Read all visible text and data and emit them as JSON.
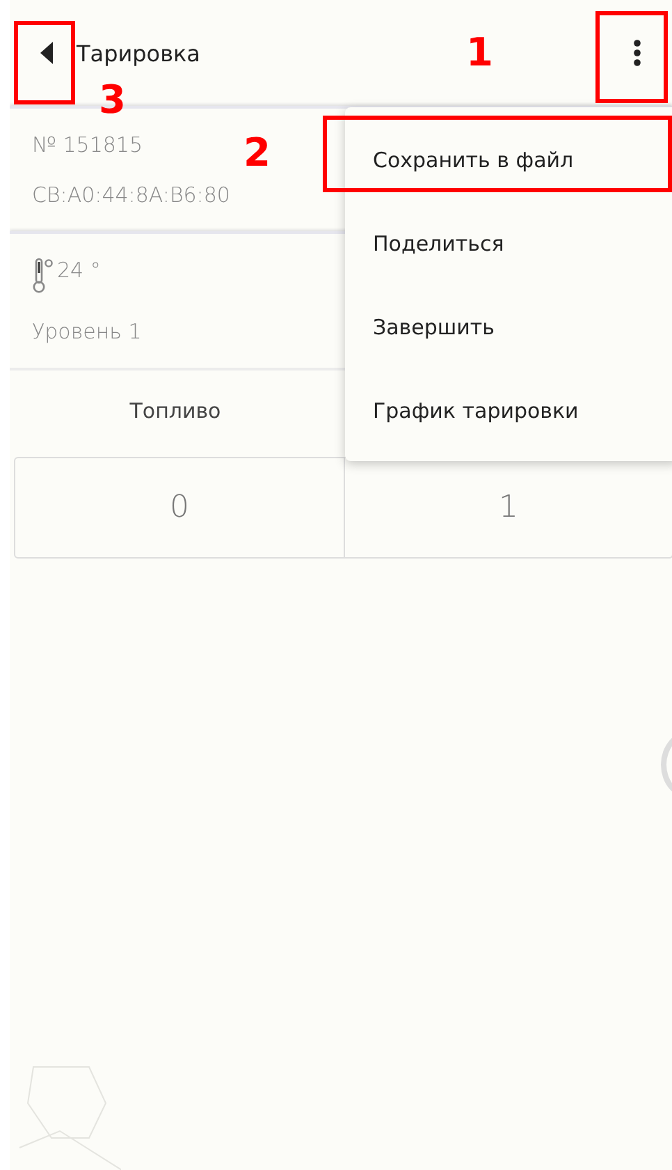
{
  "header": {
    "title": "Тарировка"
  },
  "device": {
    "number": "№ 151815",
    "mac": "CB:A0:44:8A:B6:80"
  },
  "sensor": {
    "temperature": "24 °",
    "level_label": "Уровень 1"
  },
  "table": {
    "columns": [
      "Топливо"
    ],
    "rows": [
      [
        "0",
        "1"
      ]
    ]
  },
  "menu": {
    "items": [
      {
        "label": "Сохранить в файл"
      },
      {
        "label": "Поделиться"
      },
      {
        "label": "Завершить"
      },
      {
        "label": "График тарировки"
      }
    ]
  },
  "annotations": [
    {
      "kind": "menu",
      "label": "1"
    },
    {
      "kind": "first_item",
      "label": "2"
    },
    {
      "kind": "back",
      "label": "3"
    }
  ]
}
